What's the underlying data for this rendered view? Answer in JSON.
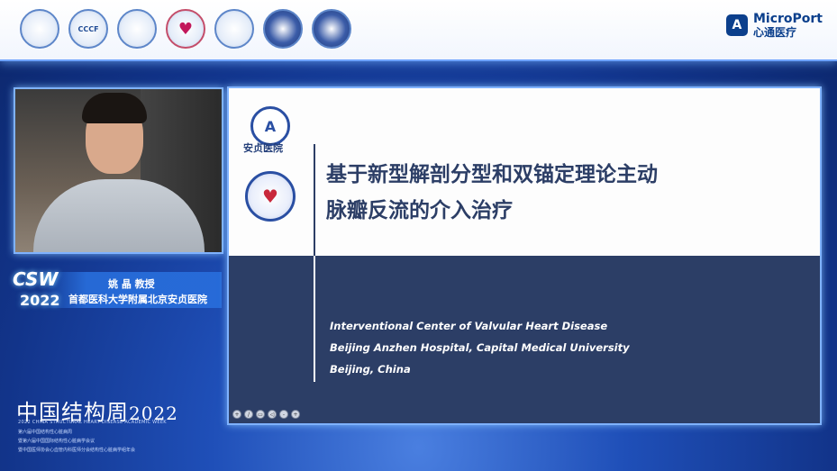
{
  "header": {
    "logos": [
      {
        "name": "society-logo-1",
        "text": ""
      },
      {
        "name": "cccf-logo",
        "text": "CCCF"
      },
      {
        "name": "society-logo-3",
        "text": ""
      },
      {
        "name": "heart-hands-logo",
        "text": "♥"
      },
      {
        "name": "society-logo-5",
        "text": ""
      },
      {
        "name": "society-logo-6",
        "text": ""
      },
      {
        "name": "society-logo-7",
        "text": ""
      }
    ],
    "brand_icon": "A",
    "brand_en": "MicroPort",
    "brand_cn": "心通医疗"
  },
  "video": {
    "event_logo_csw": "CSW",
    "event_logo_year": "2022",
    "speaker_name": "姚 晶  教授",
    "speaker_affiliation": "首都医科大学附属北京安贞医院"
  },
  "event": {
    "title_cn": "中国结构周",
    "title_year": "2022",
    "subtitle_en": "2022 CHINA STRUCTURAL HEART DISEASE ACADEMIC WEEK",
    "lines": [
      "第六届中国结构性心脏病周",
      "暨第六届中国国际结构性心脏病学会议",
      "暨中国医师协会心血管内科医师分会结构性心脏病学组年会"
    ]
  },
  "slide": {
    "hospital_logo_text": "A",
    "hospital_name": "安贞医院",
    "title_line1": "基于新型解剖分型和双锚定理论主动",
    "title_line2": "脉瓣反流的介入治疗",
    "info_line1": "Interventional Center of Valvular Heart Disease",
    "info_line2": "Beijing Anzhen Hospital, Capital Medical University",
    "info_line3": "Beijing, China"
  },
  "controls": [
    "+",
    "/",
    "▭",
    "◁",
    "-",
    "+"
  ]
}
